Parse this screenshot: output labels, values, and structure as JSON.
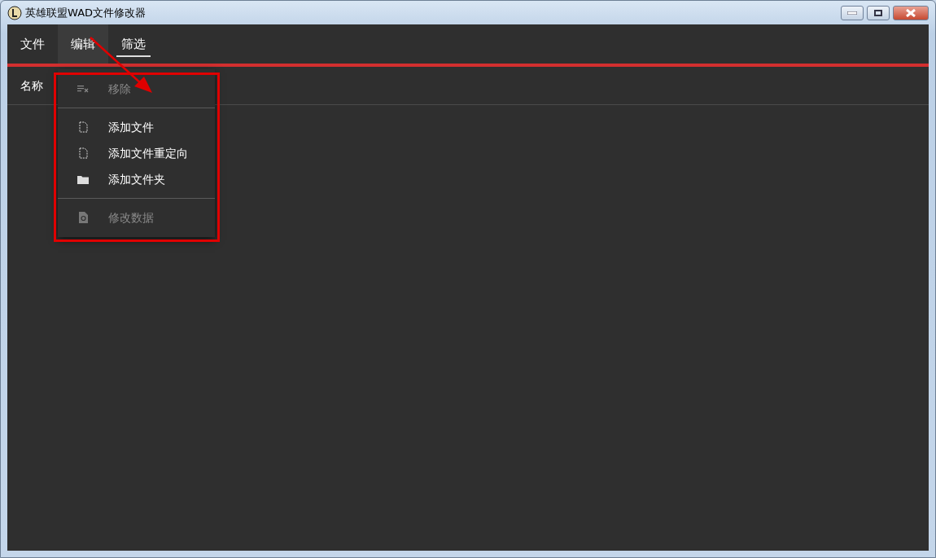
{
  "window": {
    "title": "英雄联盟WAD文件修改器"
  },
  "tabs": [
    {
      "label": "文件",
      "selected": false,
      "open": false
    },
    {
      "label": "编辑",
      "selected": false,
      "open": true
    },
    {
      "label": "筛选",
      "selected": true,
      "open": false
    }
  ],
  "table": {
    "columns": [
      "名称"
    ]
  },
  "menu": [
    {
      "kind": "item",
      "label": "移除",
      "disabled": true
    },
    {
      "kind": "divider"
    },
    {
      "kind": "item",
      "label": "添加文件",
      "disabled": false
    },
    {
      "kind": "item",
      "label": "添加文件重定向",
      "disabled": false
    },
    {
      "kind": "item",
      "label": "添加文件夹",
      "disabled": false
    },
    {
      "kind": "divider"
    },
    {
      "kind": "item",
      "label": "修改数据",
      "disabled": true
    }
  ]
}
